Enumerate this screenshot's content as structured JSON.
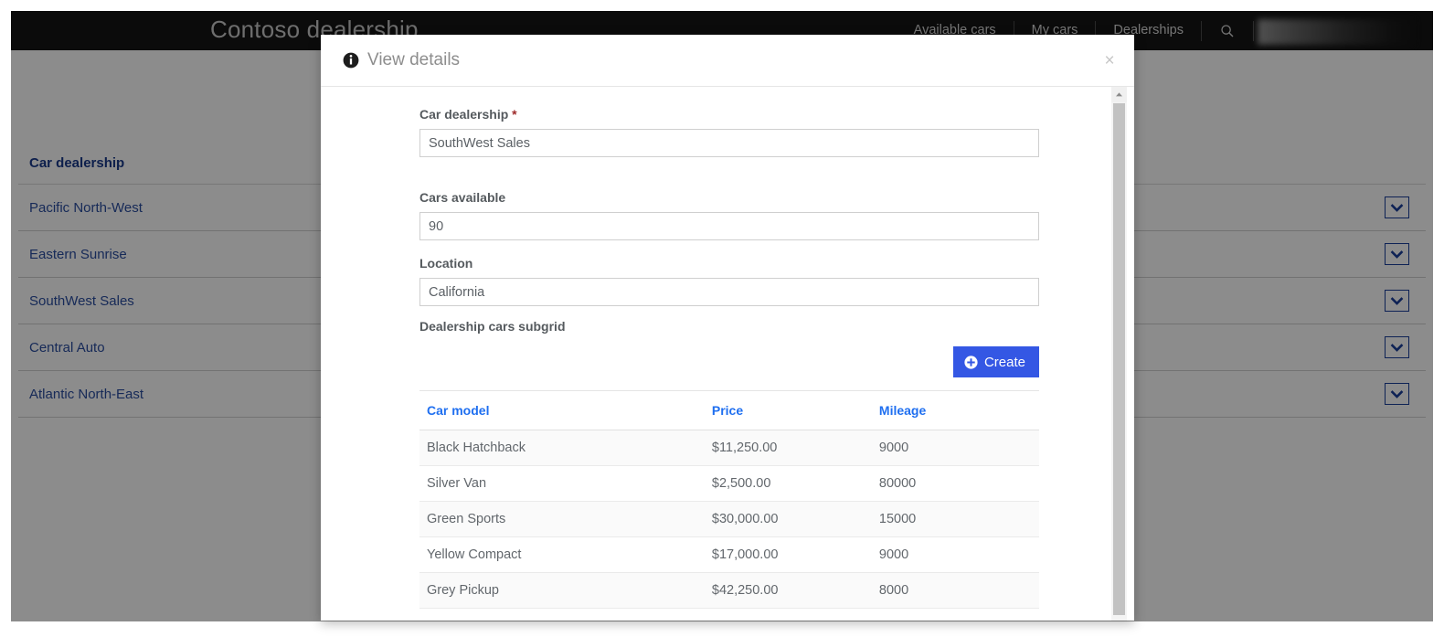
{
  "nav": {
    "brand": "Contoso dealership",
    "links": [
      "Available cars",
      "My cars",
      "Dealerships"
    ],
    "search_icon": "search-icon",
    "user_area": ""
  },
  "background_table": {
    "header": "Car dealership",
    "rows": [
      "Pacific North-West",
      "Eastern Sunrise",
      "SouthWest Sales",
      "Central Auto",
      "Atlantic North-East"
    ],
    "row_action_icon": "chevron-down-icon"
  },
  "modal": {
    "title": "View details",
    "title_icon": "info-icon",
    "close_label": "×",
    "fields": [
      {
        "label": "Car dealership",
        "required": true,
        "required_mark": "*",
        "value": "SouthWest Sales",
        "placeholder": "Car dealership"
      },
      {
        "label": "Cars available",
        "required": false,
        "value": "90",
        "placeholder": "Cars available"
      },
      {
        "label": "Location",
        "required": false,
        "value": "California",
        "placeholder": "Location"
      }
    ],
    "subgrid": {
      "label": "Dealership cars subgrid",
      "create_button": "Create",
      "create_icon": "plus-circle-icon",
      "columns": [
        "Car model",
        "Price",
        "Mileage"
      ],
      "rows": [
        {
          "model": "Black Hatchback",
          "price": "$11,250.00",
          "mileage": "9000"
        },
        {
          "model": "Silver Van",
          "price": "$2,500.00",
          "mileage": "80000"
        },
        {
          "model": "Green Sports",
          "price": "$30,000.00",
          "mileage": "15000"
        },
        {
          "model": "Yellow Compact",
          "price": "$17,000.00",
          "mileage": "9000"
        },
        {
          "model": "Grey Pickup",
          "price": "$42,250.00",
          "mileage": "8000"
        }
      ]
    }
  },
  "colors": {
    "nav_background": "#141414",
    "link_blue": "#2a4ea0",
    "header_blue": "#19398a",
    "subgrid_header_blue": "#1f6ff0",
    "create_button_blue": "#3457e4",
    "required_red": "#9e2a2a",
    "overlay": "rgba(0,0,0,0.45)"
  }
}
